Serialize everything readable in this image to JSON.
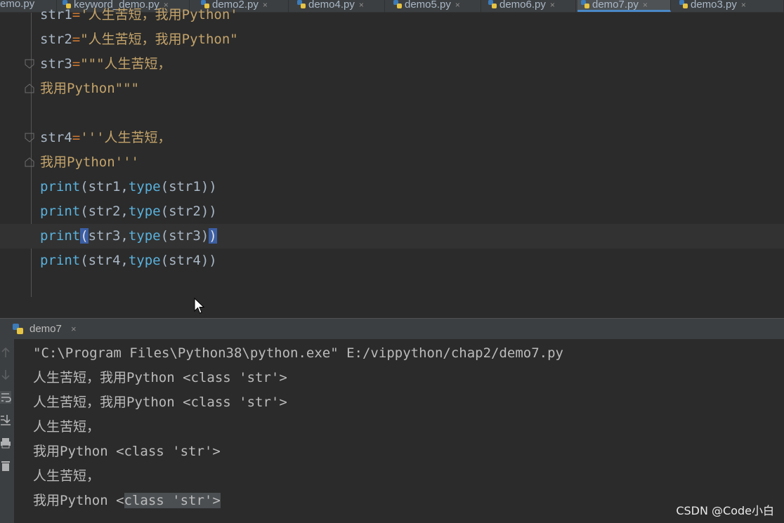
{
  "tabs": [
    {
      "label": "emo.py",
      "active": false
    },
    {
      "label": "keyword_demo.py",
      "active": false
    },
    {
      "label": "demo2.py",
      "active": false
    },
    {
      "label": "demo4.py",
      "active": false
    },
    {
      "label": "demo5.py",
      "active": false
    },
    {
      "label": "demo6.py",
      "active": false
    },
    {
      "label": "demo7.py",
      "active": true
    },
    {
      "label": "demo3.py",
      "active": false
    }
  ],
  "close_glyph": "×",
  "code": {
    "l1": {
      "a": "str1",
      "b": "=",
      "c": "'人生苦短，我用Python'"
    },
    "l2": {
      "a": "str2",
      "b": "=",
      "c": "\"人生苦短，我用Python\""
    },
    "l3": {
      "a": "str3",
      "b": "=",
      "c": "\"\"\"人生苦短，"
    },
    "l4": {
      "c": "我用Python\"\"\""
    },
    "l5": {
      "a": "str4",
      "b": "=",
      "c": "'''人生苦短，"
    },
    "l6": {
      "c": "我用Python'''"
    },
    "p1": {
      "fn": "print",
      "open": "(",
      "arg": "str1,",
      "ty": "type",
      "rest": "(str1)",
      "close": ")"
    },
    "p2": {
      "fn": "print",
      "open": "(",
      "arg": "str2,",
      "ty": "type",
      "rest": "(str2)",
      "close": ")"
    },
    "p3": {
      "fn": "print",
      "open": "(",
      "arg": "str3,",
      "ty": "type",
      "rest": "(str3)",
      "close": ")"
    },
    "p4": {
      "fn": "print",
      "open": "(",
      "arg": "str4,",
      "ty": "type",
      "rest": "(str4)",
      "close": ")"
    }
  },
  "run_panel": {
    "tab_label": "demo7",
    "output": [
      "\"C:\\Program Files\\Python38\\python.exe\" E:/vippython/chap2/demo7.py",
      "人生苦短，我用Python <class 'str'>",
      "人生苦短，我用Python <class 'str'>",
      "人生苦短，",
      "我用Python <class 'str'>",
      "人生苦短，"
    ],
    "last_prefix": "我用Python <",
    "last_selected": "class 'str'>"
  },
  "watermark": "CSDN @Code小白",
  "colors": {
    "keyword": "#cc7832",
    "string": "#c3a36a",
    "builtin": "#59b2de",
    "bg": "#2b2b2b"
  }
}
